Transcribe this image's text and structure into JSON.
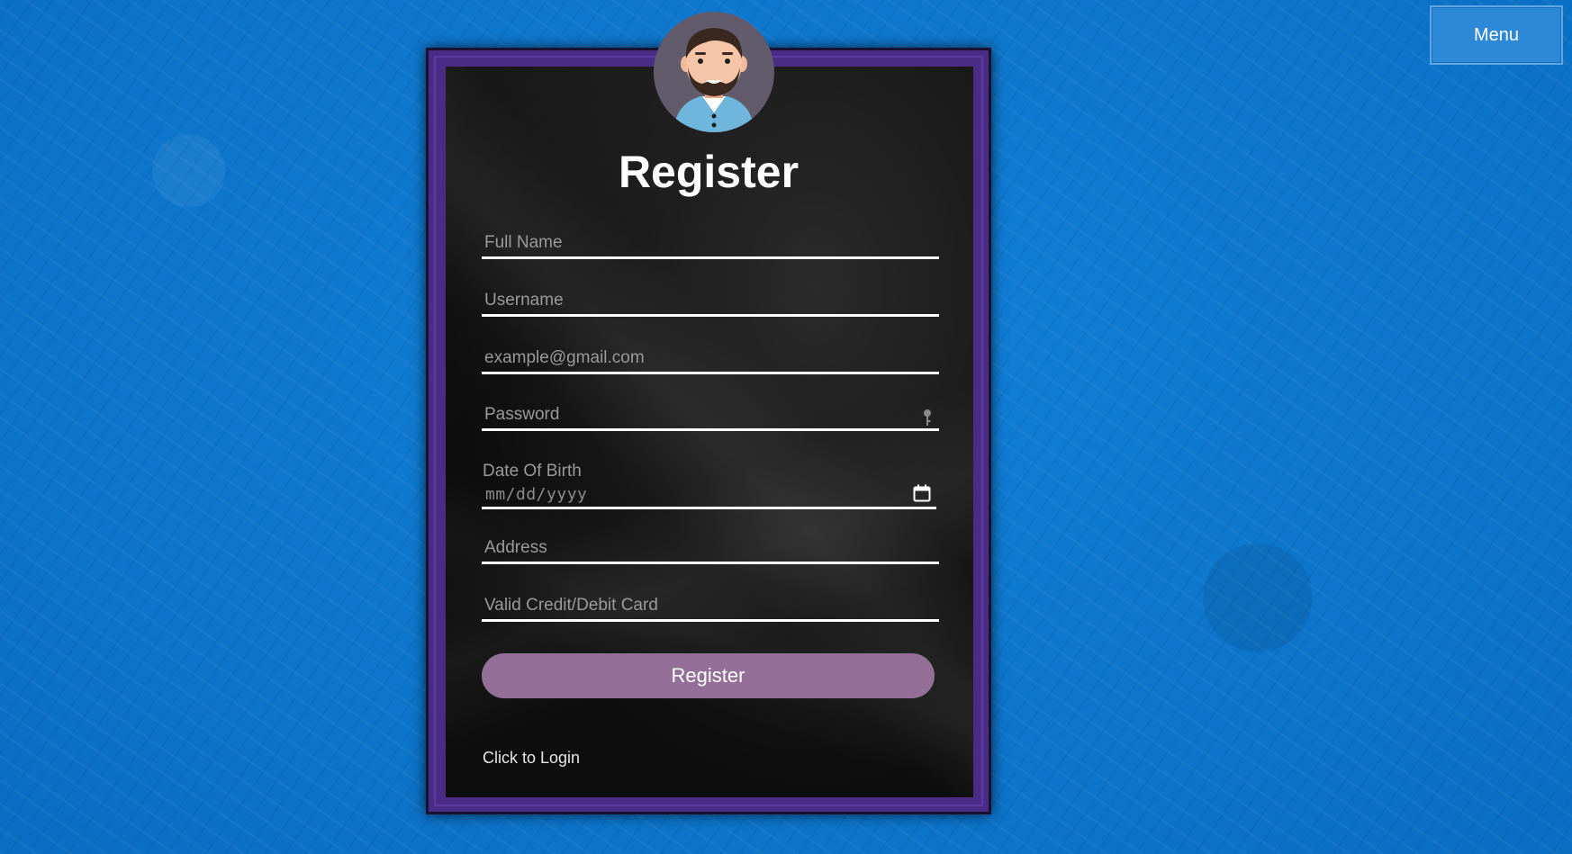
{
  "menu": {
    "label": "Menu"
  },
  "form": {
    "title": "Register",
    "fields": {
      "full_name": {
        "placeholder": "Full Name",
        "value": ""
      },
      "username": {
        "placeholder": "Username",
        "value": ""
      },
      "email": {
        "placeholder": "example@gmail.com",
        "value": ""
      },
      "password": {
        "placeholder": "Password",
        "value": ""
      },
      "dob": {
        "label": "Date Of Birth",
        "placeholder": "mm/dd/yyyy"
      },
      "address": {
        "placeholder": "Address",
        "value": ""
      },
      "card": {
        "placeholder": "Valid Credit/Debit Card",
        "value": ""
      }
    },
    "submit_label": "Register",
    "login_link": "Click to Login"
  },
  "icons": {
    "avatar": "user-avatar",
    "password": "key-icon",
    "dob": "calendar-icon"
  },
  "colors": {
    "background": "#0c77cf",
    "frame": "#4a2c86",
    "button": "#946f97",
    "menu": "#2e88d8"
  }
}
